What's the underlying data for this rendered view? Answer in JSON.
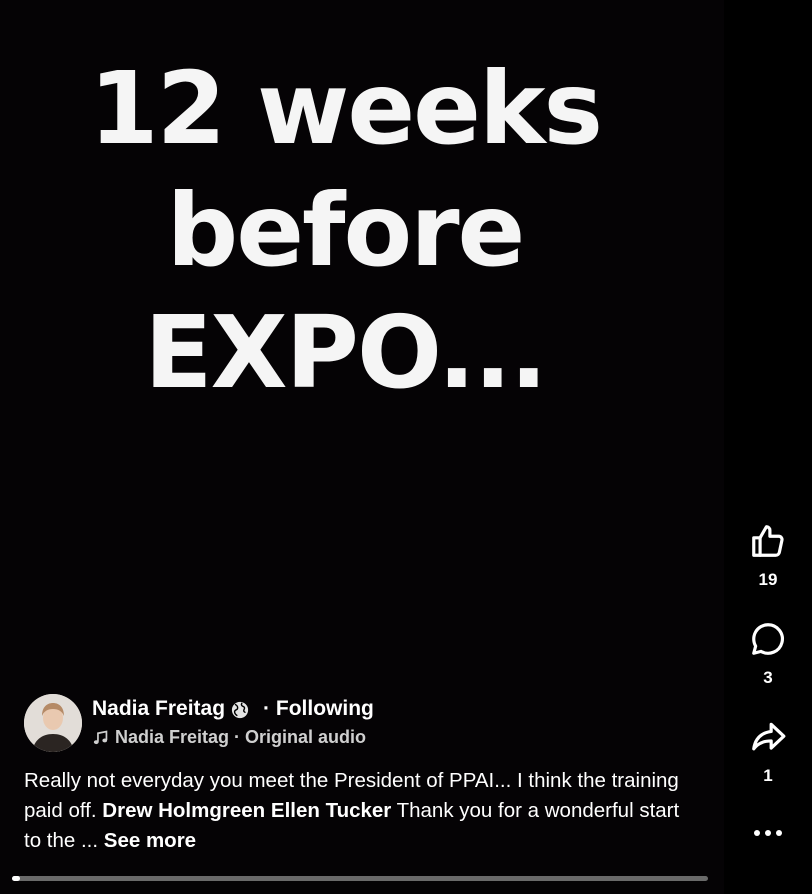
{
  "video": {
    "overlay_lines": [
      "12 weeks",
      "before",
      "EXPO..."
    ]
  },
  "actions": {
    "like_count": "19",
    "comment_count": "3",
    "share_count": "1"
  },
  "author": {
    "name": "Nadia Freitag",
    "follow_status": "· Following",
    "audio_label": "Nadia Freitag · Original audio"
  },
  "caption": {
    "text_before_tags": "Really not everyday you meet the President of PPAI... I think the training paid off. ",
    "tag_1": "Drew Holmgreen",
    "tag_2": "Ellen Tucker",
    "text_after_tags": " Thank you for a wonderful start to the ... ",
    "see_more": "See more"
  },
  "playback": {
    "progress_fraction": 0.012
  },
  "icons": {
    "like": "thumbs-up-icon",
    "comment": "comment-bubble-icon",
    "share": "share-arrow-icon",
    "more": "more-dots-icon",
    "privacy": "globe-icon",
    "audio": "music-note-icon"
  }
}
